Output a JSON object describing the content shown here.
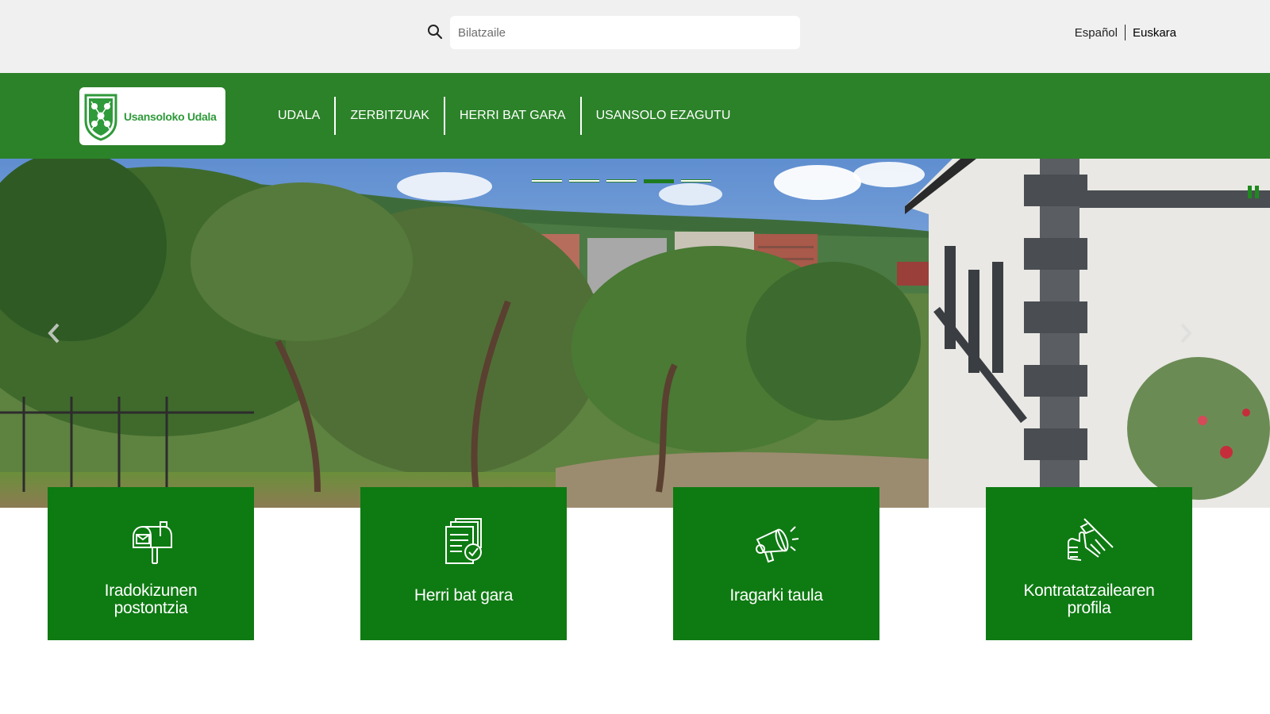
{
  "search": {
    "placeholder": "Bilatzaile"
  },
  "languages": [
    {
      "label": "Español",
      "active": false
    },
    {
      "label": "Euskara",
      "active": true
    }
  ],
  "logo": {
    "text": "Usansoloko Udala"
  },
  "nav": {
    "items": [
      {
        "label": "UDALA"
      },
      {
        "label": "ZERBITZUAK"
      },
      {
        "label": "HERRI BAT GARA"
      },
      {
        "label": "USANSOLO EZAGUTU"
      }
    ]
  },
  "carousel": {
    "slide_count": 5,
    "active_slide": 4
  },
  "cards": [
    {
      "label": "Iradokizunen\npostontzia",
      "icon": "mailbox-icon"
    },
    {
      "label": "Herri bat gara",
      "icon": "documents-check-icon"
    },
    {
      "label": "Iragarki taula",
      "icon": "megaphone-icon"
    },
    {
      "label": "Kontratatzailearen\nprofila",
      "icon": "handshake-icon"
    }
  ],
  "colors": {
    "nav_green": "#2c8229",
    "card_green": "#0e7a12",
    "topbar_bg": "#f0f0f0"
  }
}
